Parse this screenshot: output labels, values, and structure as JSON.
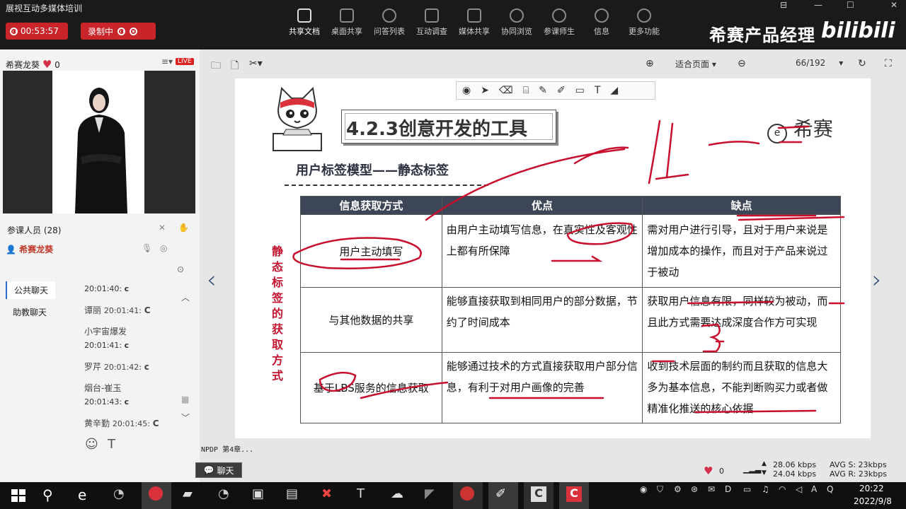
{
  "window": {
    "title": "展视互动多媒体培训",
    "controls": [
      "⊟",
      "—",
      "☐",
      "✕"
    ]
  },
  "session": {
    "timer": "00:53:57",
    "record_label": "录制中"
  },
  "toolbar": {
    "items": [
      "共享文档",
      "桌面共享",
      "问答列表",
      "互动调查",
      "媒体共享",
      "协同浏览",
      "参课师生",
      "信息",
      "更多功能"
    ]
  },
  "brand": {
    "text": "希赛产品经理",
    "logo": "bilibili"
  },
  "presenter": {
    "name": "希赛龙葵",
    "likes": "0",
    "live": "LIVE"
  },
  "participants": {
    "label": "参课人员 (28)",
    "host": "希赛龙葵"
  },
  "chat": {
    "tabs": [
      "公共聊天",
      "助教聊天"
    ],
    "messages": [
      {
        "name": "",
        "time": "20:01:40:",
        "text": "c"
      },
      {
        "name": "谭丽",
        "time": "20:01:41:",
        "text": "C"
      },
      {
        "name": "小宇宙爆发",
        "time": "20:01:41:",
        "text": "c"
      },
      {
        "name": "罗芹",
        "time": "20:01:42:",
        "text": "c"
      },
      {
        "name": "烟台-崔玉",
        "time": "20:01:43:",
        "text": "c"
      },
      {
        "name": "黄辛勤",
        "time": "20:01:45:",
        "text": "C"
      }
    ],
    "button": "聊天",
    "emoji": "☺",
    "font": "T"
  },
  "doc_toolbar": {
    "zoom": "适合页面",
    "page": "66/192"
  },
  "slide": {
    "section": "4.2.3创意开发的工具",
    "logo": "希赛",
    "subtitle": "用户标签模型——静态标签",
    "side_label": "静态标签的获取方式",
    "headers": [
      "信息获取方式",
      "优点",
      "缺点"
    ],
    "rows": [
      [
        "用户主动填写",
        "由用户主动填写信息，在真实性及客观性上都有所保障",
        "需对用户进行引导，且对于用户来说是增加成本的操作，而且对于产品来说过于被动"
      ],
      [
        "与其他数据的共享",
        "能够直接获取到相同用户的部分数据，节约了时间成本",
        "获取用户信息有限，同样较为被动，而且此方式需要达成深度合作方可实现"
      ],
      [
        "基于LBS服务的信息获取",
        "能够通过技术的方式直接获取用户部分信息，有利于对用户画像的完善",
        "收到技术层面的制约而且获取的信息大多为基本信息，不能判断购买力或者做精准化推送的核心依据"
      ]
    ],
    "colors": {
      "header_bg": "#3c4656",
      "side_label": "#c4122f",
      "pen": "#c8102e"
    }
  },
  "status": {
    "file": "NPDP 第4章...",
    "likes": "0",
    "up_kbps": "28.06 kbps",
    "down_kbps": "24.04 kbps",
    "avg_s": "AVG S: 23kbps",
    "avg_r": "AVG R: 23kbps"
  },
  "tray": {
    "time": "20:22",
    "date": "2022/9/8",
    "ime": "A"
  }
}
